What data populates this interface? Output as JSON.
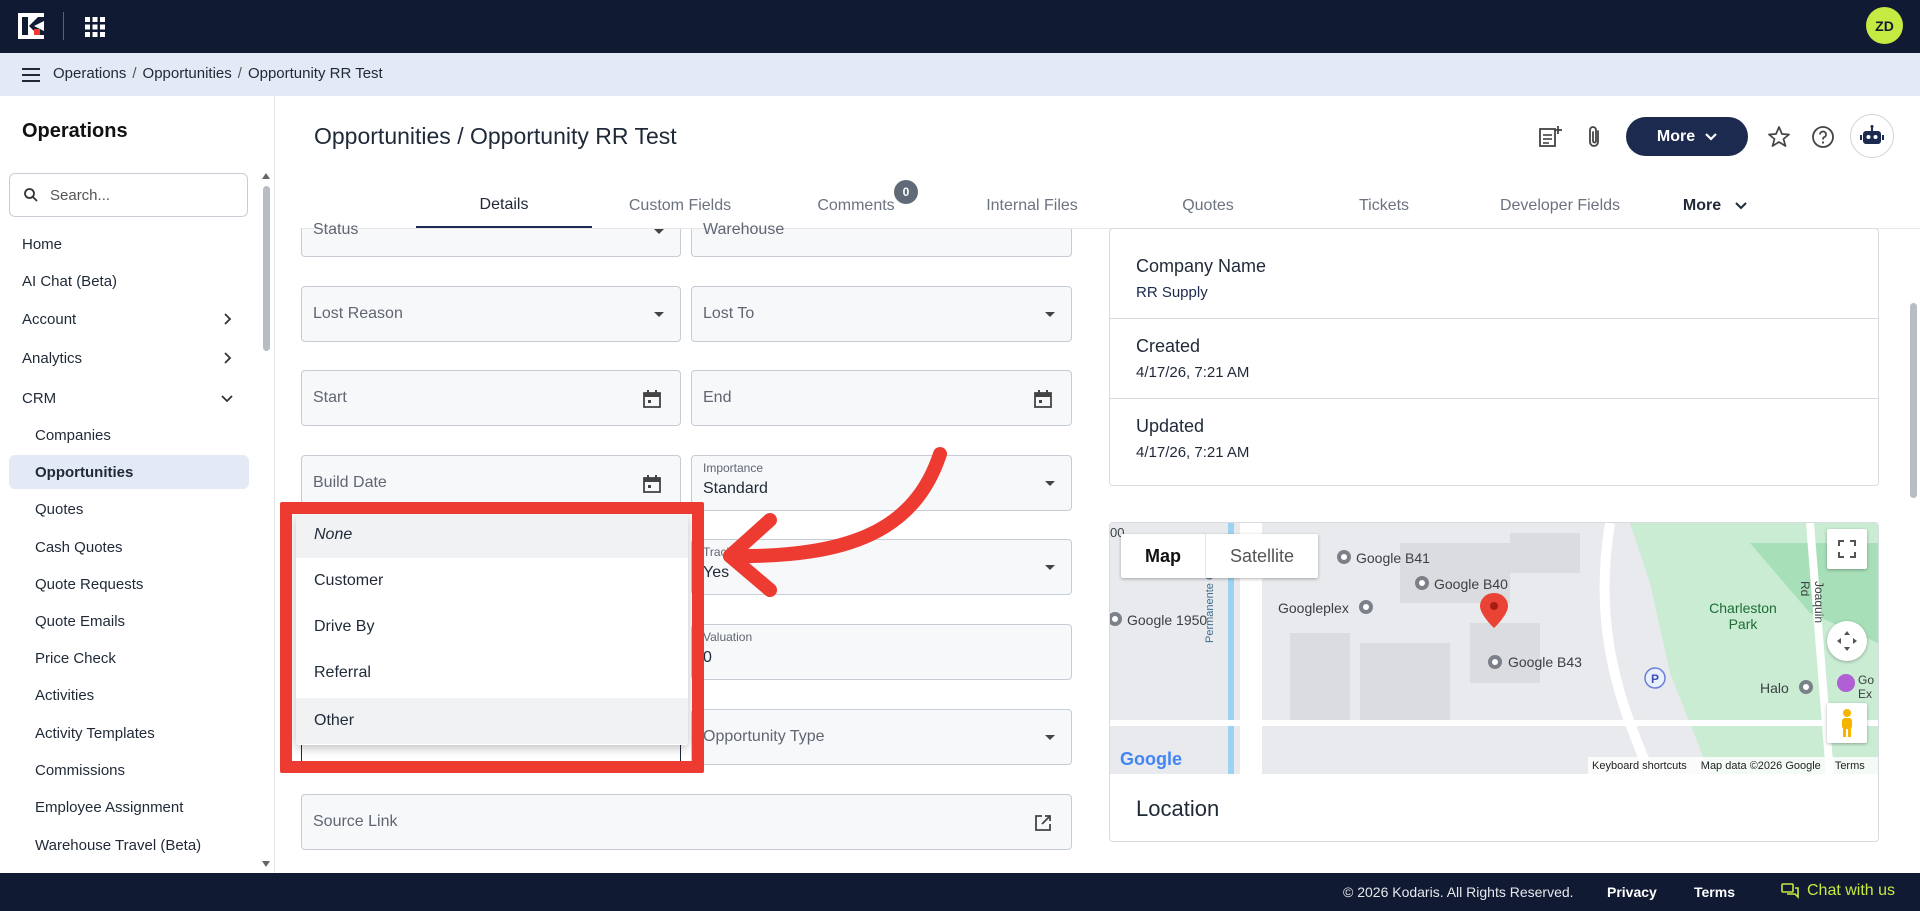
{
  "topbar": {
    "avatar_initials": "ZD",
    "logo_icon": "kodaris-logo",
    "apps_icon": "apps-grid-icon"
  },
  "breadcrumb": [
    "Operations",
    "Opportunities",
    "Opportunity RR Test"
  ],
  "sidebar": {
    "title": "Operations",
    "search_placeholder": "Search...",
    "items": [
      {
        "label": "Home",
        "level": "top"
      },
      {
        "label": "AI Chat (Beta)",
        "level": "top"
      },
      {
        "label": "Account",
        "level": "top",
        "chevron": "right"
      },
      {
        "label": "Analytics",
        "level": "top",
        "chevron": "right"
      },
      {
        "label": "CRM",
        "level": "top",
        "chevron": "down"
      },
      {
        "label": "Companies",
        "level": "sub"
      },
      {
        "label": "Opportunities",
        "level": "sub",
        "active": true
      },
      {
        "label": "Quotes",
        "level": "sub"
      },
      {
        "label": "Cash Quotes",
        "level": "sub"
      },
      {
        "label": "Quote Requests",
        "level": "sub"
      },
      {
        "label": "Quote Emails",
        "level": "sub"
      },
      {
        "label": "Price Check",
        "level": "sub"
      },
      {
        "label": "Activities",
        "level": "sub"
      },
      {
        "label": "Activity Templates",
        "level": "sub"
      },
      {
        "label": "Commissions",
        "level": "sub"
      },
      {
        "label": "Employee Assignment",
        "level": "sub"
      },
      {
        "label": "Warehouse Travel (Beta)",
        "level": "sub"
      }
    ]
  },
  "header": {
    "title": "Opportunities / Opportunity RR Test",
    "more_label": "More"
  },
  "tabs": {
    "items": [
      "Details",
      "Custom Fields",
      "Comments",
      "Internal Files",
      "Quotes",
      "Tickets",
      "Developer Fields",
      "More"
    ],
    "comments_count": "0"
  },
  "form": {
    "status": "Status",
    "warehouse": "Warehouse",
    "lost_reason": "Lost Reason",
    "lost_to": "Lost To",
    "start": "Start",
    "end": "End",
    "build_date": "Build Date",
    "importance_label": "Importance",
    "importance_value": "Standard",
    "tracking_label": "Tracking",
    "tracking_value": "Yes",
    "valuation_label": "Valuation",
    "valuation_value": "0",
    "opportunity_type": "Opportunity Type",
    "source_link": "Source Link"
  },
  "dropdown": {
    "options": [
      "None",
      "Customer",
      "Drive By",
      "Referral",
      "Other"
    ]
  },
  "info": [
    {
      "key": "Company Name",
      "value": "RR Supply"
    },
    {
      "key": "Created",
      "value": "4/17/26, 7:21 AM"
    },
    {
      "key": "Updated",
      "value": "4/17/26, 7:21 AM"
    }
  ],
  "map": {
    "toggle": [
      "Map",
      "Satellite"
    ],
    "places": [
      "Google B41",
      "Google B40",
      "Googleplex",
      "Google 1950",
      "Google B43",
      "Charleston Park",
      "Halo",
      "Permanente Creek",
      "Joaquin Rd",
      "Go Ex"
    ],
    "footer": [
      "Keyboard shortcuts",
      "Map data ©2026 Google",
      "Terms"
    ],
    "brand": "Google",
    "title": "Location"
  },
  "footer": {
    "copyright": "© 2026 Kodaris. All Rights Reserved.",
    "privacy": "Privacy",
    "terms": "Terms",
    "chat": "Chat with us"
  },
  "colors": {
    "navy": "#111a33",
    "accent": "#c5ea41",
    "highlight_red": "#ee3b32",
    "active_nav": "#e3e9f5"
  }
}
